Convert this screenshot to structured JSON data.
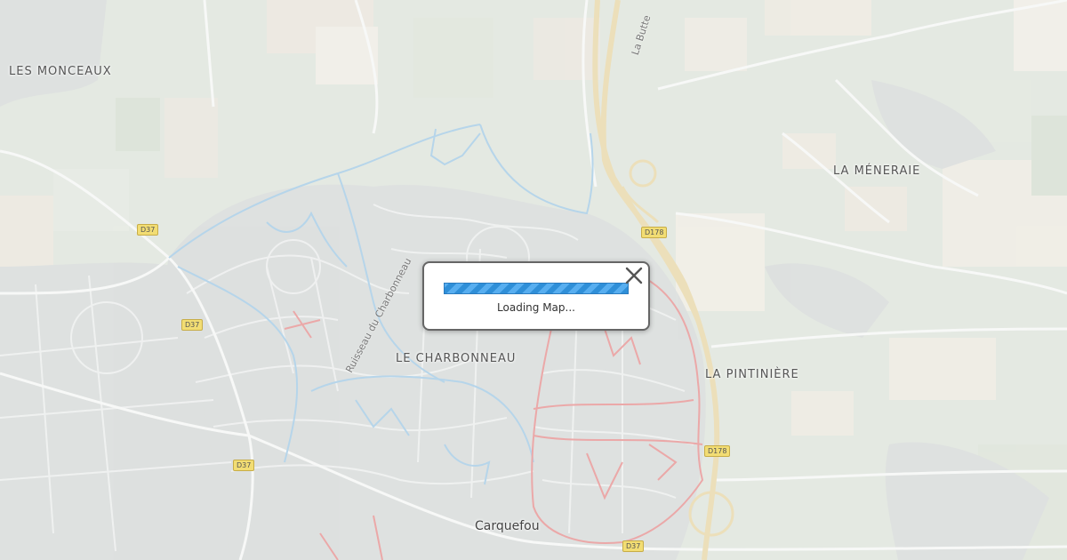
{
  "map": {
    "places": [
      {
        "name": "LES MONCEAUX"
      },
      {
        "name": "LA MÉNERAIE"
      },
      {
        "name": "LE CHARBONNEAU"
      },
      {
        "name": "LA PINTINIÈRE"
      }
    ],
    "town": "Carquefou",
    "roads": {
      "d37_a": "D37",
      "d37_b": "D37",
      "d37_c": "D37",
      "d37_d": "D37",
      "d178_a": "D178",
      "d178_b": "D178"
    },
    "street_names": {
      "la_butte": "La Butte",
      "ruisseau": "Ruisseau du Charbonneau"
    }
  },
  "dialog": {
    "loading_text": "Loading Map...",
    "close_icon": "close-icon"
  }
}
